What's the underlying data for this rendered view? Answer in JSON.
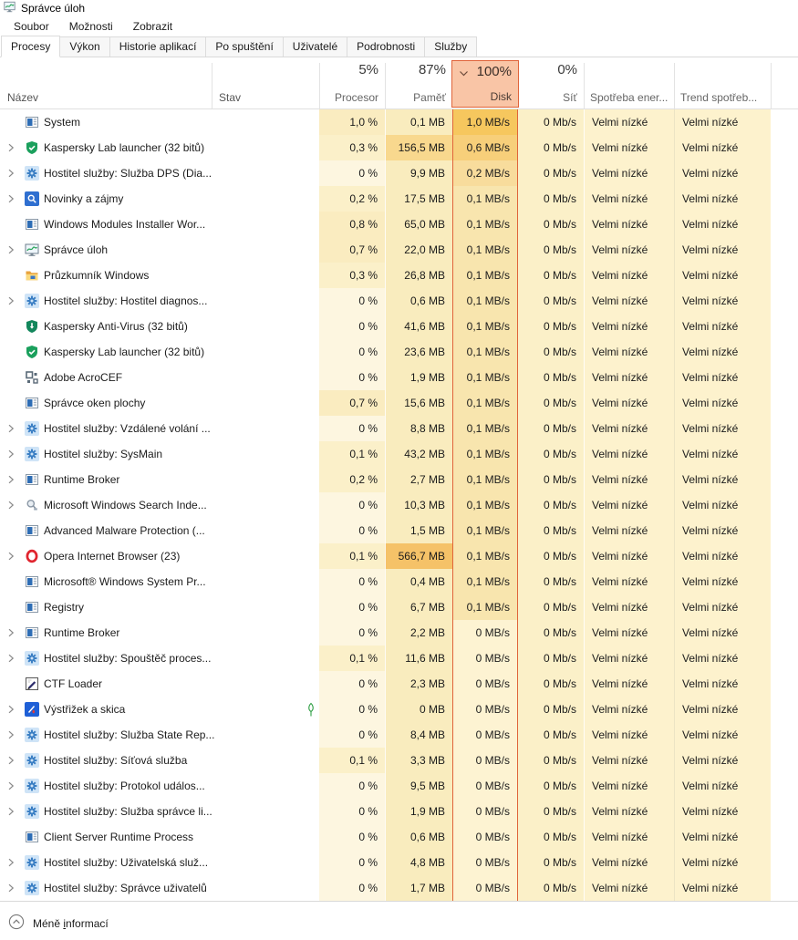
{
  "window": {
    "title": "Správce úloh",
    "app_icon": "task-manager-icon"
  },
  "menu": {
    "items": [
      "Soubor",
      "Možnosti",
      "Zobrazit"
    ]
  },
  "tabs": {
    "items": [
      {
        "label": "Procesy",
        "active": true
      },
      {
        "label": "Výkon",
        "active": false
      },
      {
        "label": "Historie aplikací",
        "active": false
      },
      {
        "label": "Po spuštění",
        "active": false
      },
      {
        "label": "Uživatelé",
        "active": false
      },
      {
        "label": "Podrobnosti",
        "active": false
      },
      {
        "label": "Služby",
        "active": false
      }
    ]
  },
  "columns": {
    "name_label": "Název",
    "status_label": "Stav",
    "stats": [
      {
        "key": "cpu",
        "percent": "5%",
        "label": "Procesor",
        "selected": false
      },
      {
        "key": "mem",
        "percent": "87%",
        "label": "Paměť",
        "selected": false
      },
      {
        "key": "disk",
        "percent": "100%",
        "label": "Disk",
        "selected": true
      },
      {
        "key": "net",
        "percent": "0%",
        "label": "Síť",
        "selected": false
      },
      {
        "key": "power",
        "percent": "",
        "label": "Spotřeba ener...",
        "selected": false
      },
      {
        "key": "trend",
        "percent": "",
        "label": "Trend spotřeb...",
        "selected": false
      }
    ]
  },
  "processes": [
    {
      "name": "System",
      "expandable": false,
      "icon": "window",
      "status": "",
      "cpu": "1,0 %",
      "mem": "0,1 MB",
      "disk": "1,0 MB/s",
      "net": "0 Mb/s",
      "power": "Velmi nízké",
      "trend": "Velmi nízké"
    },
    {
      "name": "Kaspersky Lab launcher (32 bitů)",
      "expandable": true,
      "icon": "shield-check",
      "status": "",
      "cpu": "0,3 %",
      "mem": "156,5 MB",
      "disk": "0,6 MB/s",
      "net": "0 Mb/s",
      "power": "Velmi nízké",
      "trend": "Velmi nízké"
    },
    {
      "name": "Hostitel služby: Služba DPS (Dia...",
      "expandable": true,
      "icon": "gear",
      "status": "",
      "cpu": "0 %",
      "mem": "9,9 MB",
      "disk": "0,2 MB/s",
      "net": "0 Mb/s",
      "power": "Velmi nízké",
      "trend": "Velmi nízké"
    },
    {
      "name": "Novinky a zájmy",
      "expandable": true,
      "icon": "news",
      "status": "",
      "cpu": "0,2 %",
      "mem": "17,5 MB",
      "disk": "0,1 MB/s",
      "net": "0 Mb/s",
      "power": "Velmi nízké",
      "trend": "Velmi nízké"
    },
    {
      "name": "Windows Modules Installer Wor...",
      "expandable": false,
      "icon": "window",
      "status": "",
      "cpu": "0,8 %",
      "mem": "65,0 MB",
      "disk": "0,1 MB/s",
      "net": "0 Mb/s",
      "power": "Velmi nízké",
      "trend": "Velmi nízké"
    },
    {
      "name": "Správce úloh",
      "expandable": true,
      "icon": "taskmgr",
      "status": "",
      "cpu": "0,7 %",
      "mem": "22,0 MB",
      "disk": "0,1 MB/s",
      "net": "0 Mb/s",
      "power": "Velmi nízké",
      "trend": "Velmi nízké"
    },
    {
      "name": "Průzkumník Windows",
      "expandable": false,
      "icon": "folder",
      "status": "",
      "cpu": "0,3 %",
      "mem": "26,8 MB",
      "disk": "0,1 MB/s",
      "net": "0 Mb/s",
      "power": "Velmi nízké",
      "trend": "Velmi nízké"
    },
    {
      "name": "Hostitel služby: Hostitel diagnos...",
      "expandable": true,
      "icon": "gear",
      "status": "",
      "cpu": "0 %",
      "mem": "0,6 MB",
      "disk": "0,1 MB/s",
      "net": "0 Mb/s",
      "power": "Velmi nízké",
      "trend": "Velmi nízké"
    },
    {
      "name": "Kaspersky Anti-Virus (32 bitů)",
      "expandable": false,
      "icon": "shield-arrow",
      "status": "",
      "cpu": "0 %",
      "mem": "41,6 MB",
      "disk": "0,1 MB/s",
      "net": "0 Mb/s",
      "power": "Velmi nízké",
      "trend": "Velmi nízké"
    },
    {
      "name": "Kaspersky Lab launcher (32 bitů)",
      "expandable": false,
      "icon": "shield-check",
      "status": "",
      "cpu": "0 %",
      "mem": "23,6 MB",
      "disk": "0,1 MB/s",
      "net": "0 Mb/s",
      "power": "Velmi nízké",
      "trend": "Velmi nízké"
    },
    {
      "name": "Adobe AcroCEF",
      "expandable": false,
      "icon": "squares",
      "status": "",
      "cpu": "0 %",
      "mem": "1,9 MB",
      "disk": "0,1 MB/s",
      "net": "0 Mb/s",
      "power": "Velmi nízké",
      "trend": "Velmi nízké"
    },
    {
      "name": "Správce oken plochy",
      "expandable": false,
      "icon": "window",
      "status": "",
      "cpu": "0,7 %",
      "mem": "15,6 MB",
      "disk": "0,1 MB/s",
      "net": "0 Mb/s",
      "power": "Velmi nízké",
      "trend": "Velmi nízké"
    },
    {
      "name": "Hostitel služby: Vzdálené volání ...",
      "expandable": true,
      "icon": "gear",
      "status": "",
      "cpu": "0 %",
      "mem": "8,8 MB",
      "disk": "0,1 MB/s",
      "net": "0 Mb/s",
      "power": "Velmi nízké",
      "trend": "Velmi nízké"
    },
    {
      "name": "Hostitel služby: SysMain",
      "expandable": true,
      "icon": "gear",
      "status": "",
      "cpu": "0,1 %",
      "mem": "43,2 MB",
      "disk": "0,1 MB/s",
      "net": "0 Mb/s",
      "power": "Velmi nízké",
      "trend": "Velmi nízké"
    },
    {
      "name": "Runtime Broker",
      "expandable": true,
      "icon": "window",
      "status": "",
      "cpu": "0,2 %",
      "mem": "2,7 MB",
      "disk": "0,1 MB/s",
      "net": "0 Mb/s",
      "power": "Velmi nízké",
      "trend": "Velmi nízké"
    },
    {
      "name": "Microsoft Windows Search Inde...",
      "expandable": true,
      "icon": "search",
      "status": "",
      "cpu": "0 %",
      "mem": "10,3 MB",
      "disk": "0,1 MB/s",
      "net": "0 Mb/s",
      "power": "Velmi nízké",
      "trend": "Velmi nízké"
    },
    {
      "name": "Advanced Malware Protection (...",
      "expandable": false,
      "icon": "window",
      "status": "",
      "cpu": "0 %",
      "mem": "1,5 MB",
      "disk": "0,1 MB/s",
      "net": "0 Mb/s",
      "power": "Velmi nízké",
      "trend": "Velmi nízké"
    },
    {
      "name": "Opera Internet Browser (23)",
      "expandable": true,
      "icon": "opera",
      "status": "",
      "cpu": "0,1 %",
      "mem": "566,7 MB",
      "disk": "0,1 MB/s",
      "net": "0 Mb/s",
      "power": "Velmi nízké",
      "trend": "Velmi nízké"
    },
    {
      "name": "Microsoft® Windows System Pr...",
      "expandable": false,
      "icon": "window",
      "status": "",
      "cpu": "0 %",
      "mem": "0,4 MB",
      "disk": "0,1 MB/s",
      "net": "0 Mb/s",
      "power": "Velmi nízké",
      "trend": "Velmi nízké"
    },
    {
      "name": "Registry",
      "expandable": false,
      "icon": "window",
      "status": "",
      "cpu": "0 %",
      "mem": "6,7 MB",
      "disk": "0,1 MB/s",
      "net": "0 Mb/s",
      "power": "Velmi nízké",
      "trend": "Velmi nízké"
    },
    {
      "name": "Runtime Broker",
      "expandable": true,
      "icon": "window",
      "status": "",
      "cpu": "0 %",
      "mem": "2,2 MB",
      "disk": "0 MB/s",
      "net": "0 Mb/s",
      "power": "Velmi nízké",
      "trend": "Velmi nízké"
    },
    {
      "name": "Hostitel služby: Spouštěč proces...",
      "expandable": true,
      "icon": "gear",
      "status": "",
      "cpu": "0,1 %",
      "mem": "11,6 MB",
      "disk": "0 MB/s",
      "net": "0 Mb/s",
      "power": "Velmi nízké",
      "trend": "Velmi nízké"
    },
    {
      "name": "CTF Loader",
      "expandable": false,
      "icon": "pen",
      "status": "",
      "cpu": "0 %",
      "mem": "2,3 MB",
      "disk": "0 MB/s",
      "net": "0 Mb/s",
      "power": "Velmi nízké",
      "trend": "Velmi nízké"
    },
    {
      "name": "Výstřižek a skica",
      "expandable": true,
      "icon": "snip",
      "status": "leaf",
      "cpu": "0 %",
      "mem": "0 MB",
      "disk": "0 MB/s",
      "net": "0 Mb/s",
      "power": "Velmi nízké",
      "trend": "Velmi nízké"
    },
    {
      "name": "Hostitel služby: Služba State Rep...",
      "expandable": true,
      "icon": "gear",
      "status": "",
      "cpu": "0 %",
      "mem": "8,4 MB",
      "disk": "0 MB/s",
      "net": "0 Mb/s",
      "power": "Velmi nízké",
      "trend": "Velmi nízké"
    },
    {
      "name": "Hostitel služby: Síťová služba",
      "expandable": true,
      "icon": "gear",
      "status": "",
      "cpu": "0,1 %",
      "mem": "3,3 MB",
      "disk": "0 MB/s",
      "net": "0 Mb/s",
      "power": "Velmi nízké",
      "trend": "Velmi nízké"
    },
    {
      "name": "Hostitel služby: Protokol událos...",
      "expandable": true,
      "icon": "gear",
      "status": "",
      "cpu": "0 %",
      "mem": "9,5 MB",
      "disk": "0 MB/s",
      "net": "0 Mb/s",
      "power": "Velmi nízké",
      "trend": "Velmi nízké"
    },
    {
      "name": "Hostitel služby: Služba správce li...",
      "expandable": true,
      "icon": "gear",
      "status": "",
      "cpu": "0 %",
      "mem": "1,9 MB",
      "disk": "0 MB/s",
      "net": "0 Mb/s",
      "power": "Velmi nízké",
      "trend": "Velmi nízké"
    },
    {
      "name": "Client Server Runtime Process",
      "expandable": false,
      "icon": "window",
      "status": "",
      "cpu": "0 %",
      "mem": "0,6 MB",
      "disk": "0 MB/s",
      "net": "0 Mb/s",
      "power": "Velmi nízké",
      "trend": "Velmi nízké"
    },
    {
      "name": "Hostitel služby: Uživatelská služ...",
      "expandable": true,
      "icon": "gear",
      "status": "",
      "cpu": "0 %",
      "mem": "4,8 MB",
      "disk": "0 MB/s",
      "net": "0 Mb/s",
      "power": "Velmi nízké",
      "trend": "Velmi nízké"
    },
    {
      "name": "Hostitel služby: Správce uživatelů",
      "expandable": true,
      "icon": "gear",
      "status": "",
      "cpu": "0 %",
      "mem": "1,7 MB",
      "disk": "0 MB/s",
      "net": "0 Mb/s",
      "power": "Velmi nízké",
      "trend": "Velmi nízké"
    }
  ],
  "footer": {
    "label_pre": "Méně ",
    "label_accel": "i",
    "label_post": "nformací",
    "icon": "chevron-up-circle-icon"
  },
  "colors": {
    "disk_selected_border": "#e0643a",
    "disk_selected_header_bg": "#f9c5a6",
    "heat_cpu_zero": "#fdf6e0",
    "heat_cpu_low": "#fbf0c9",
    "heat_cpu_mid": "#faecc0",
    "heat_mem_low": "#f9ecbe",
    "heat_mem_mid": "#f8d88e",
    "heat_mem_high": "#f5c268",
    "heat_disk_0": "#fdf3d2",
    "heat_disk_01": "#f8e5ae",
    "heat_disk_02": "#f8dc9c",
    "heat_disk_06": "#f7cf7a",
    "heat_disk_10": "#f6c75e",
    "heat_net": "#fbf0c8",
    "heat_power": "#fdf2cd"
  }
}
